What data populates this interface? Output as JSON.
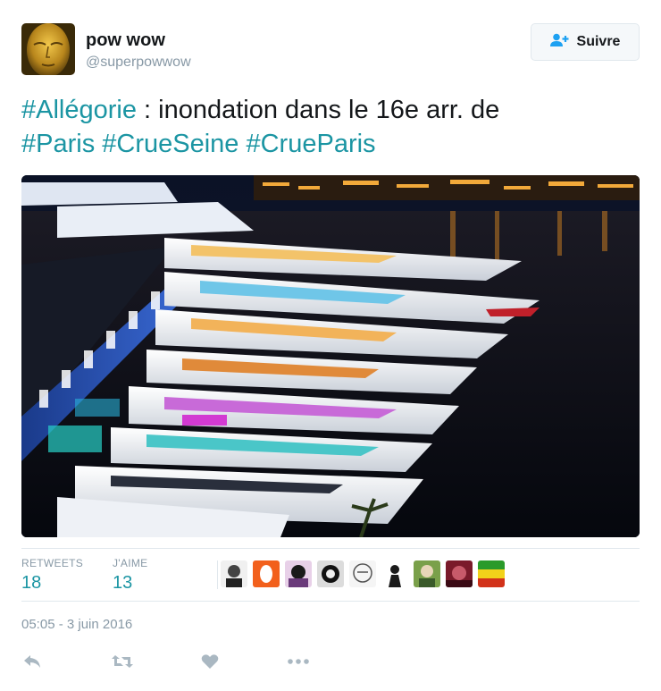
{
  "user": {
    "name": "pow wow",
    "handle": "@superpowwow"
  },
  "follow_button": {
    "label": "Suivre",
    "icon": "add-user-icon"
  },
  "tweet": {
    "segments_line1": [
      {
        "text": "#Allégorie",
        "hashtag": true
      },
      {
        "text": " : inondation dans le 16e arr. de",
        "hashtag": false
      }
    ],
    "segments_line2": [
      {
        "text": "#Paris",
        "hashtag": true
      },
      {
        "text": " ",
        "hashtag": false
      },
      {
        "text": "#CrueSeine",
        "hashtag": true
      },
      {
        "text": " ",
        "hashtag": false
      },
      {
        "text": "#CrueParis",
        "hashtag": true
      }
    ]
  },
  "stats": {
    "retweets_label": "RETWEETS",
    "retweets_value": "18",
    "likes_label": "J'AIME",
    "likes_value": "13"
  },
  "timestamp": "05:05 - 3 juin 2016",
  "actions": [
    "reply-icon",
    "retweet-icon",
    "like-icon",
    "more-icon"
  ],
  "colors": {
    "hashtag": "#1b95a3",
    "muted": "#8899a6",
    "icon": "#aab8c2"
  }
}
